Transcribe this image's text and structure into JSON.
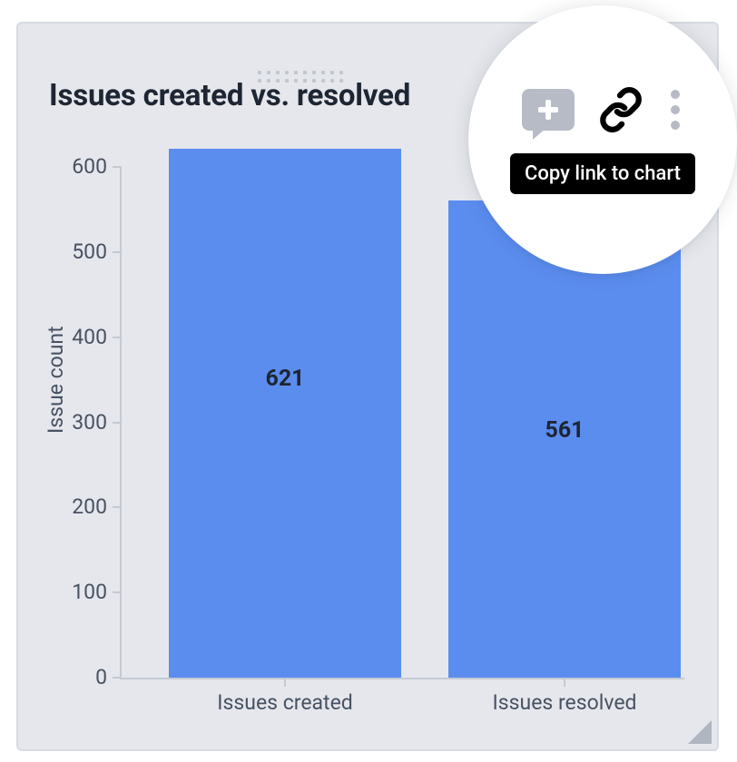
{
  "title": "Issues created vs. resolved",
  "ylabel": "Issue count",
  "toolbar": {
    "comment_icon_name": "comment-add-icon",
    "link_icon_name": "link-icon",
    "more_icon_name": "more-vertical-icon",
    "tooltip": "Copy link to chart"
  },
  "chart_data": {
    "type": "bar",
    "categories": [
      "Issues created",
      "Issues resolved"
    ],
    "values": [
      621,
      561
    ],
    "title": "Issues created vs. resolved",
    "xlabel": "",
    "ylabel": "Issue count",
    "ylim": [
      0,
      600
    ],
    "yticks": [
      0,
      100,
      200,
      300,
      400,
      500,
      600
    ],
    "bar_color": "#5b8def",
    "show_value_labels": true
  }
}
